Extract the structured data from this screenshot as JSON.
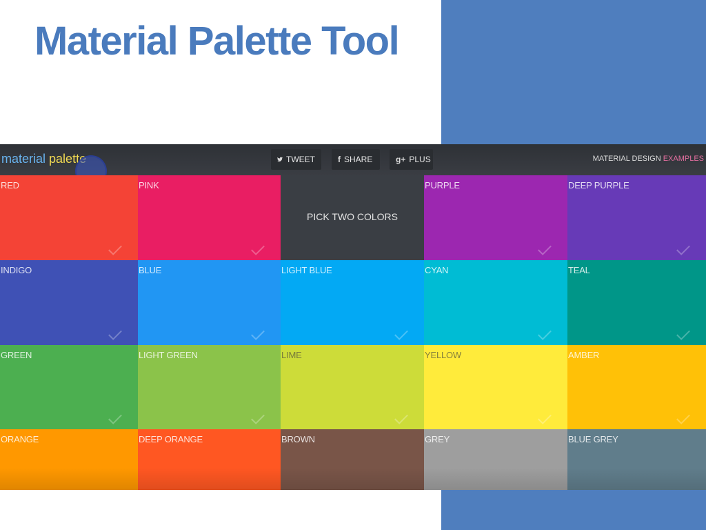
{
  "slide": {
    "title": "Material Palette Tool",
    "accent_color": "#4f7ebe"
  },
  "app": {
    "logo_part1": "material",
    "logo_part2": "palette",
    "tweet_label": "TWEET",
    "share_label": "SHARE",
    "plus_label": "PLUS",
    "tweet_icon": "twitter-icon",
    "share_icon": "facebook-icon",
    "plus_icon": "google-plus-icon",
    "md_label": "MATERIAL DESIGN",
    "examples_label": "EXAMPLES",
    "pick_label": "PICK TWO COLORS"
  },
  "swatches": [
    {
      "name": "RED",
      "color": "#f44336"
    },
    {
      "name": "PINK",
      "color": "#e91e63"
    },
    {
      "name": "",
      "color": "#3a3e44",
      "pick": true
    },
    {
      "name": "PURPLE",
      "color": "#9c27b0"
    },
    {
      "name": "DEEP PURPLE",
      "color": "#673ab7"
    },
    {
      "name": "INDIGO",
      "color": "#3f51b5"
    },
    {
      "name": "BLUE",
      "color": "#2196f3"
    },
    {
      "name": "LIGHT BLUE",
      "color": "#03a9f4"
    },
    {
      "name": "CYAN",
      "color": "#00bcd4"
    },
    {
      "name": "TEAL",
      "color": "#009688"
    },
    {
      "name": "GREEN",
      "color": "#4caf50"
    },
    {
      "name": "LIGHT GREEN",
      "color": "#8bc34a"
    },
    {
      "name": "LIME",
      "color": "#cddc39"
    },
    {
      "name": "YELLOW",
      "color": "#ffeb3b"
    },
    {
      "name": "AMBER",
      "color": "#ffc107"
    },
    {
      "name": "ORANGE",
      "color": "#ff9800"
    },
    {
      "name": "DEEP ORANGE",
      "color": "#ff5722"
    },
    {
      "name": "BROWN",
      "color": "#795548"
    },
    {
      "name": "GREY",
      "color": "#9e9e9e"
    },
    {
      "name": "BLUE GREY",
      "color": "#607d8b"
    }
  ]
}
